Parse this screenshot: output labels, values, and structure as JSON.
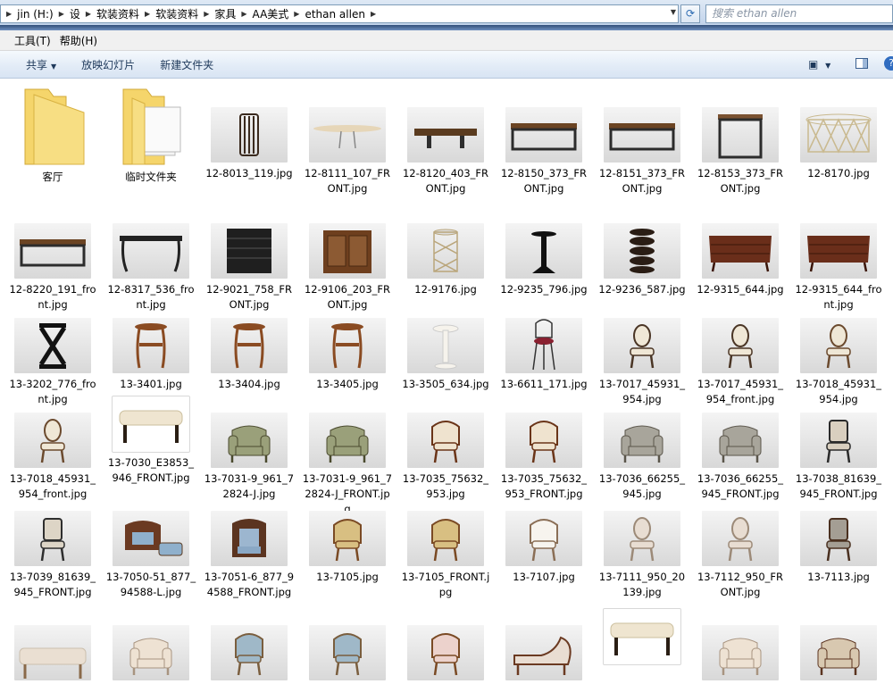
{
  "address": {
    "crumbs": [
      "jin (H:)",
      "设",
      "软装资料",
      "软装资料",
      "家具",
      "AA美式",
      "ethan allen"
    ],
    "search_placeholder": "搜索 ethan allen"
  },
  "menu": {
    "tools": "工具(T)",
    "help": "帮助(H)"
  },
  "commands": {
    "share": "共享",
    "slideshow": "放映幻灯片",
    "new_folder": "新建文件夹"
  },
  "colors": {
    "folder": "#f5d56b",
    "wood": "#7a4a24",
    "accent": "#2f6cc0"
  },
  "files": [
    {
      "name": "客厅",
      "type": "folder"
    },
    {
      "name": "临时文件夹",
      "type": "folder"
    },
    {
      "name": "12-8013_119.jpg",
      "icon": "round-stand-icon"
    },
    {
      "name": "12-8111_107_FRONT.jpg",
      "icon": "oval-table-icon"
    },
    {
      "name": "12-8120_403_FRONT.jpg",
      "icon": "bench-icon"
    },
    {
      "name": "12-8150_373_FRONT.jpg",
      "icon": "coffee-table-icon"
    },
    {
      "name": "12-8151_373_FRONT.jpg",
      "icon": "coffee-table-icon"
    },
    {
      "name": "12-8153_373_FRONT.jpg",
      "icon": "side-table-icon"
    },
    {
      "name": "12-8170.jpg",
      "icon": "lattice-table-icon"
    },
    {
      "name": "12-8220_191_front.jpg",
      "icon": "coffee-table-icon"
    },
    {
      "name": "12-8317_536_front.jpg",
      "icon": "console-icon"
    },
    {
      "name": "12-9021_758_FRONT.jpg",
      "icon": "chest-icon"
    },
    {
      "name": "12-9106_203_FRONT.jpg",
      "icon": "cabinet-icon"
    },
    {
      "name": "12-9176.jpg",
      "icon": "lattice-stand-icon"
    },
    {
      "name": "12-9235_796.jpg",
      "icon": "pedestal-icon"
    },
    {
      "name": "12-9236_587.jpg",
      "icon": "stack-table-icon"
    },
    {
      "name": "12-9315_644.jpg",
      "icon": "commode-icon"
    },
    {
      "name": "12-9315_644_front.jpg",
      "icon": "commode-icon"
    },
    {
      "name": "13-3202_776_front.jpg",
      "icon": "x-stool-icon"
    },
    {
      "name": "13-3401.jpg",
      "icon": "wood-stand-icon"
    },
    {
      "name": "13-3404.jpg",
      "icon": "wood-stand-icon"
    },
    {
      "name": "13-3405.jpg",
      "icon": "wood-stand-icon"
    },
    {
      "name": "13-3505_634.jpg",
      "icon": "white-stand-icon"
    },
    {
      "name": "13-6611_171.jpg",
      "icon": "bar-stool-icon"
    },
    {
      "name": "13-7017_45931_954.jpg",
      "icon": "oval-chair-icon"
    },
    {
      "name": "13-7017_45931_954_front.jpg",
      "icon": "oval-chair-icon"
    },
    {
      "name": "13-7018_45931_954.jpg",
      "icon": "armchair-icon"
    },
    {
      "name": "13-7018_45931_954_front.jpg",
      "icon": "armchair-icon"
    },
    {
      "name": "13-7030_E3853_946_FRONT.jpg",
      "icon": "ottoman-icon"
    },
    {
      "name": "13-7031-9_961_72824-J.jpg",
      "icon": "club-chair-icon"
    },
    {
      "name": "13-7031-9_961_72824-J_FRONT.jpg",
      "icon": "club-chair-icon"
    },
    {
      "name": "13-7035_75632_953.jpg",
      "icon": "carved-chair-icon"
    },
    {
      "name": "13-7035_75632_953_FRONT.jpg",
      "icon": "carved-chair-icon"
    },
    {
      "name": "13-7036_66255_945.jpg",
      "icon": "grey-chair-icon"
    },
    {
      "name": "13-7036_66255_945_FRONT.jpg",
      "icon": "grey-chair-icon"
    },
    {
      "name": "13-7038_81639_945_FRONT.jpg",
      "icon": "side-chair-icon"
    },
    {
      "name": "13-7039_81639_945_FRONT.jpg",
      "icon": "arm-side-chair-icon"
    },
    {
      "name": "13-7050-51_877_94588-L.jpg",
      "icon": "chair-ottoman-icon"
    },
    {
      "name": "13-7051-6_877_94588_FRONT.jpg",
      "icon": "pattern-chair-icon"
    },
    {
      "name": "13-7105.jpg",
      "icon": "floral-chair-icon"
    },
    {
      "name": "13-7105_FRONT.jpg",
      "icon": "floral-chair-icon"
    },
    {
      "name": "13-7107.jpg",
      "icon": "white-bergere-icon"
    },
    {
      "name": "13-7111_950_20139.jpg",
      "icon": "cream-chair-icon"
    },
    {
      "name": "13-7112_950_FRONT.jpg",
      "icon": "cream-chair-icon"
    },
    {
      "name": "13-7113.jpg",
      "icon": "grey-bergere-icon"
    },
    {
      "name": "",
      "icon": "bench-cream-icon"
    },
    {
      "name": "",
      "icon": "cream-armchair-icon"
    },
    {
      "name": "",
      "icon": "blue-chair-icon"
    },
    {
      "name": "",
      "icon": "blue-chair-icon"
    },
    {
      "name": "",
      "icon": "pink-chair-icon"
    },
    {
      "name": "",
      "icon": "chaise-icon"
    },
    {
      "name": "",
      "icon": "ottoman-icon"
    },
    {
      "name": "",
      "icon": "cream-armchair-icon"
    },
    {
      "name": "",
      "icon": "wood-armchair-icon"
    }
  ]
}
